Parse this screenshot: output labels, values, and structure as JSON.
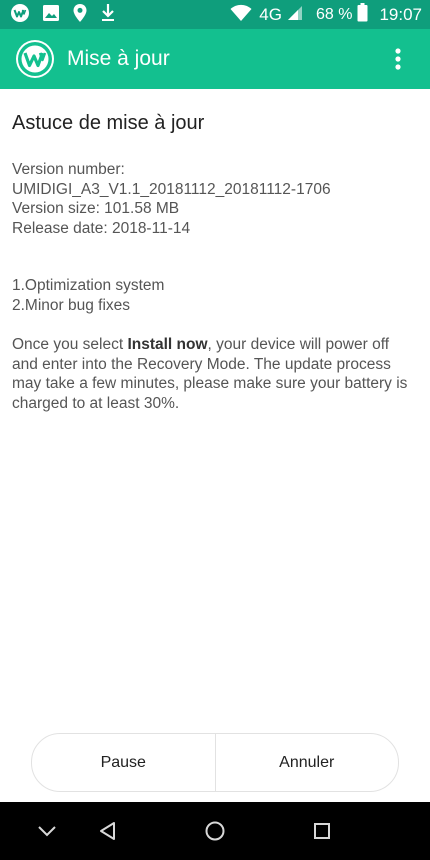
{
  "status_bar": {
    "network_type": "4G",
    "battery_percent": "68 %",
    "time": "19:07",
    "icons": [
      "umidigi-notification-icon",
      "image-icon",
      "location-icon",
      "download-icon",
      "wifi-icon",
      "signal-icon",
      "battery-icon"
    ]
  },
  "app_bar": {
    "title": "Mise à jour",
    "logo_icon": "umidigi-logo-icon",
    "menu_icon": "overflow-menu-icon"
  },
  "content": {
    "heading": "Astuce de mise à jour",
    "version_number_label": "Version number:",
    "version_number": "UMIDIGI_A3_V1.1_20181112_20181112-1706",
    "version_size": "Version size: 101.58 MB",
    "release_date": "Release date: 2018-11-14",
    "changes": [
      "1.Optimization system",
      "2.Minor bug fixes"
    ],
    "notice_prefix": "Once you select ",
    "notice_bold": "Install now",
    "notice_suffix": ", your device will power off and enter into the Recovery Mode. The update process may take a few minutes, please make sure your battery is charged to at least 30%."
  },
  "buttons": {
    "pause": "Pause",
    "cancel": "Annuler"
  },
  "nav_bar": {
    "icons": [
      "chevron-down-icon",
      "back-icon",
      "home-icon",
      "recents-icon"
    ]
  },
  "colors": {
    "status_bar": "#0f9e7c",
    "app_bar": "#13c08f",
    "nav_bar": "#000000"
  }
}
